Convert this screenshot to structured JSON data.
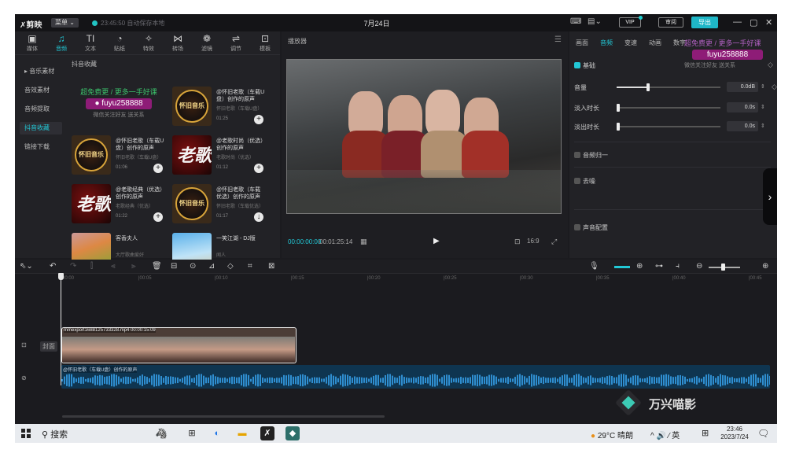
{
  "titlebar": {
    "app_name": "剪映",
    "menu_label": "菜单 ⌄",
    "status": "23:45:50 自动保存本地",
    "project_title": "7月24日",
    "vip_label": "VIP",
    "review_label": "审阅",
    "export_label": "导出",
    "window_controls": [
      "—",
      "▢",
      "✕"
    ]
  },
  "media_tools": [
    {
      "icon": "media-icon",
      "glyph": "▣",
      "label": "媒体"
    },
    {
      "icon": "audio-icon",
      "glyph": "♫",
      "label": "音频",
      "active": true
    },
    {
      "icon": "text-icon",
      "glyph": "TI",
      "label": "文本"
    },
    {
      "icon": "sticker-icon",
      "glyph": "◔",
      "label": "贴纸"
    },
    {
      "icon": "effects-icon",
      "glyph": "✧",
      "label": "特效"
    },
    {
      "icon": "transition-icon",
      "glyph": "⋈",
      "label": "转场"
    },
    {
      "icon": "filter-icon",
      "glyph": "❁",
      "label": "滤镜"
    },
    {
      "icon": "adjust-icon",
      "glyph": "⇌",
      "label": "调节"
    },
    {
      "icon": "template-icon",
      "glyph": "⊡",
      "label": "模板"
    }
  ],
  "media_side": [
    {
      "label": "▸ 音乐素材"
    },
    {
      "label": "音效素材"
    },
    {
      "label": "音频提取"
    },
    {
      "label": "抖音收藏",
      "active": true
    },
    {
      "label": "链接下载"
    }
  ],
  "media_grid_title": "抖音收藏",
  "watermark": {
    "line1": "超免费更 / 更多一手好课",
    "account": "fuyu258888",
    "line3": "微信关注好友 送关系"
  },
  "music_cards": [
    {
      "title": "@怀旧老歌（车载U盘）创作的原声",
      "sub": "怀旧老歌（车载U盘）",
      "duration": "01:25",
      "thumb_text": "怀旧音乐",
      "style": "disc",
      "action": "+"
    },
    {
      "title": "@怀旧老歌（车载U盘）创作的原声",
      "sub": "怀旧老歌（车载U盘）",
      "duration": "01:06",
      "thumb_text": "怀旧音乐",
      "style": "disc",
      "action": "+"
    },
    {
      "title": "@老歌时尚（优选）创作的原声",
      "sub": "老歌时尚（优选）",
      "duration": "01:12",
      "thumb_text": "老歌",
      "style": "calli",
      "action": "+"
    },
    {
      "title": "@老歌经典（优选）创作的原声",
      "sub": "老歌经典（优选）",
      "duration": "01:22",
      "thumb_text": "老歌",
      "style": "calli",
      "action": "+"
    },
    {
      "title": "@怀旧老歌（车载优选）创作的原声",
      "sub": "怀旧老歌（车载优选）",
      "duration": "01:17",
      "thumb_text": "怀旧音乐",
      "style": "disc",
      "action": "↓"
    },
    {
      "title": "客香夫人",
      "sub": "大厅歌曲爱好",
      "duration": "",
      "thumb_text": "",
      "style": "photo",
      "action": ""
    },
    {
      "title": "一笑江湖 - DJ版",
      "sub": "闻人",
      "duration": "",
      "thumb_text": "",
      "style": "photo2",
      "action": ""
    }
  ],
  "player": {
    "title": "播放器",
    "current_time": "00:00:00:00",
    "duration": "00:01:25:14",
    "play_icon": "▶",
    "ratio_label": "16:9"
  },
  "props": {
    "tabs": [
      {
        "label": "画面"
      },
      {
        "label": "音频",
        "active": true
      },
      {
        "label": "变速"
      },
      {
        "label": "动画"
      },
      {
        "label": "数字"
      }
    ],
    "basic_label": "基础",
    "volume_label": "音量",
    "volume_value": "0.0dB",
    "volume_level": 0.3,
    "fade_in_label": "淡入时长",
    "fade_in_value": "0.0s",
    "fade_out_label": "淡出时长",
    "fade_out_value": "0.0s",
    "normalize_label": "音频归一",
    "denoise_label": "去噪",
    "voice_label": "声音配置"
  },
  "timeline": {
    "ruler_ticks": [
      "00:00",
      "|00:05",
      "|00:10",
      "|00:15",
      "|00:20",
      "|00:25",
      "|00:30",
      "|00:35",
      "|00:40",
      "|00:45"
    ],
    "cover_label": "封面",
    "video_clip_name": "mmexport1688125733328.mp4  00:00:15:09",
    "audio_clip_name": "@怀旧老歌（车载U盘）创作的原声"
  },
  "brand": {
    "name": "万兴喵影"
  },
  "taskbar": {
    "search_label": "搜索",
    "weather": "29°C 晴朗",
    "tray": "^ 🔊 ⁄ 英",
    "time": "23:46",
    "date": "2023/7/24"
  },
  "colors": {
    "accent": "#22c8d6",
    "bg": "#1b1b1f",
    "panel": "#222226",
    "audio_track": "#0f3550",
    "watermark_purple": "#8e1c77"
  }
}
